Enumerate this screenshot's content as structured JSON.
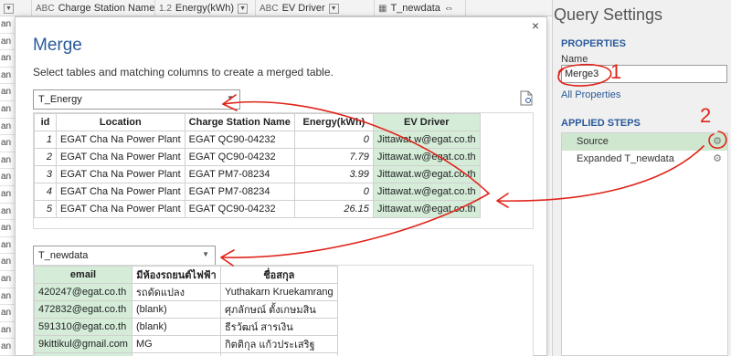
{
  "background": {
    "columns": [
      {
        "label": "Charge Station Name",
        "type": "ABC"
      },
      {
        "label": "Energy(kWh)",
        "type": "1.2"
      },
      {
        "label": "EV Driver",
        "type": "ABC"
      },
      {
        "label": "T_newdata",
        "type": "table"
      }
    ],
    "row_stub": "an"
  },
  "dialog": {
    "title": "Merge",
    "description": "Select tables and matching columns to create a merged table.",
    "close": "×",
    "table1_select": "T_Energy",
    "table2_select": "T_newdata",
    "table1": {
      "headers": [
        "id",
        "Location",
        "Charge Station Name",
        "Energy(kWh)",
        "EV Driver"
      ],
      "rows": [
        [
          "1",
          "EGAT Cha Na Power Plant",
          "EGAT QC90-04232",
          "0",
          "Jittawat.w@egat.co.th"
        ],
        [
          "2",
          "EGAT Cha Na Power Plant",
          "EGAT QC90-04232",
          "7.79",
          "Jittawat.w@egat.co.th"
        ],
        [
          "3",
          "EGAT Cha Na Power Plant",
          "EGAT PM7-08234",
          "3.99",
          "Jittawat.w@egat.co.th"
        ],
        [
          "4",
          "EGAT Cha Na Power Plant",
          "EGAT PM7-08234",
          "0",
          "Jittawat.w@egat.co.th"
        ],
        [
          "5",
          "EGAT Cha Na Power Plant",
          "EGAT QC90-04232",
          "26.15",
          "Jittawat.w@egat.co.th"
        ]
      ]
    },
    "table2": {
      "headers": [
        "email",
        "มีห้องรถยนต์ไฟฟ้า",
        "ชื่อสกุล"
      ],
      "rows": [
        [
          "420247@egat.co.th",
          "รถดัดแปลง",
          "Yuthakarn Kruekamrang"
        ],
        [
          "472832@egat.co.th",
          "(blank)",
          "ศุภลักษณ์ ตั้งเกษมสิน"
        ],
        [
          "591310@egat.co.th",
          "(blank)",
          "ธีรวัฒน์ สารเงิน"
        ],
        [
          "9kittikul@gmail.com",
          "MG",
          "กิตติกุล แก้วประเสริฐ"
        ],
        [
          "",
          "",
          ""
        ]
      ]
    }
  },
  "query_settings": {
    "title": "Query Settings",
    "properties_heading": "PROPERTIES",
    "name_label": "Name",
    "name_value": "Merge3",
    "all_properties": "All Properties",
    "applied_steps_heading": "APPLIED STEPS",
    "steps": [
      "Source",
      "Expanded T_newdata"
    ]
  },
  "annotations": {
    "label_1": "1",
    "label_2": "2",
    "color": "#e0241a"
  },
  "colors": {
    "accent": "#2a5a9a",
    "selected_column": "#d4ecd8",
    "selected_step": "#cfe6cf"
  }
}
